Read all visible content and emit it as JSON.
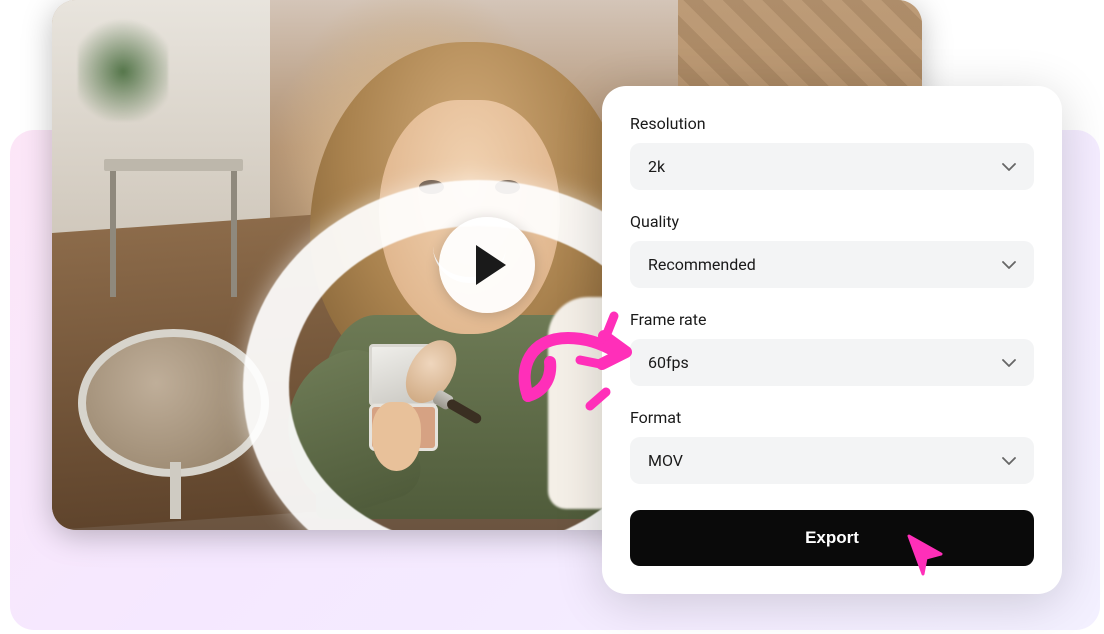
{
  "panel": {
    "resolution": {
      "label": "Resolution",
      "value": "2k"
    },
    "quality": {
      "label": "Quality",
      "value": "Recommended"
    },
    "framerate": {
      "label": "Frame rate",
      "value": "60fps"
    },
    "format": {
      "label": "Format",
      "value": "MOV"
    },
    "export_button": "Export"
  },
  "colors": {
    "accent": "#ff2fb9",
    "panel_bg": "#ffffff",
    "dropdown_bg": "#f3f4f5",
    "button_bg": "#0a0a0a"
  }
}
